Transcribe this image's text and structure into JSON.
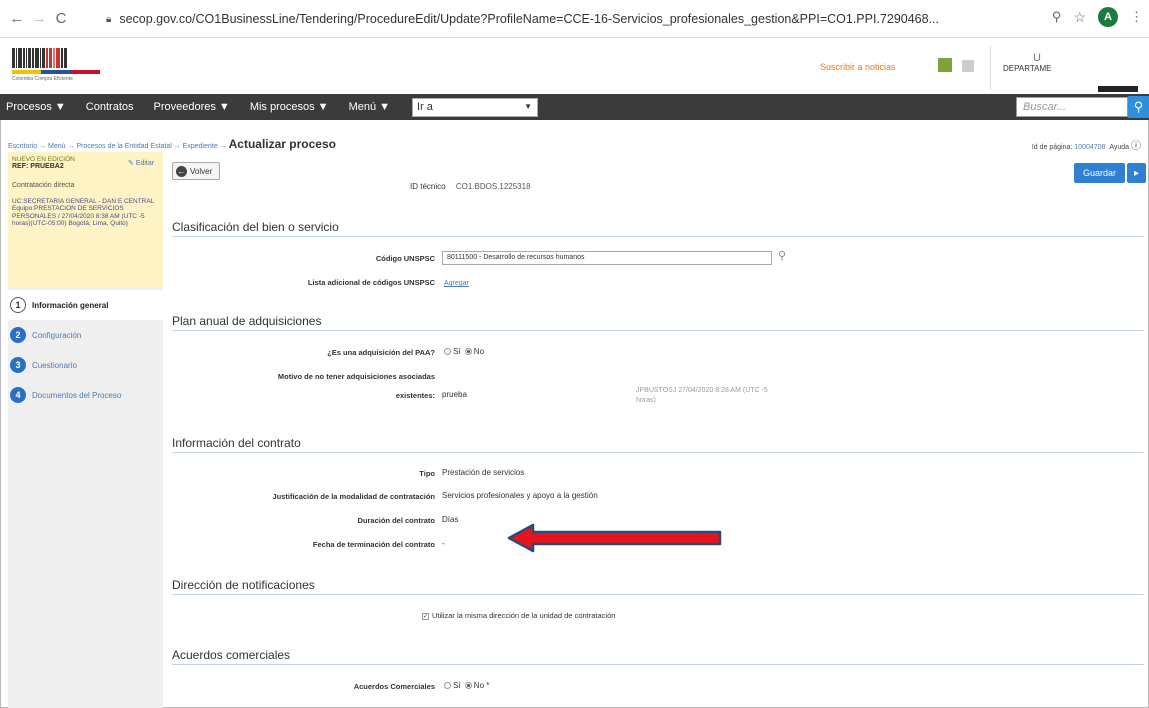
{
  "browser": {
    "url": "secop.gov.co/CO1BusinessLine/Tendering/ProcedureEdit/Update?ProfileName=CCE-16-Servicios_profesionales_gestion&PPI=CO1.PPI.7290468...",
    "avatar_letter": "A"
  },
  "header": {
    "logo_tagline": "Colombia Compra Eficiente",
    "links": "Suscribir a noticias",
    "dept_initials": "U",
    "dept_label": "DEPARTAME"
  },
  "menu": {
    "items": [
      "Procesos ▼",
      "Contratos",
      "Proveedores ▼",
      "Mis procesos ▼",
      "Menú ▼"
    ],
    "goto_value": "Ir a",
    "search_placeholder": "Buscar..."
  },
  "breadcrumb": {
    "path": "Escritorio → Menú → Procesos de la Entidad Estatal → Expediente → ",
    "current": "Actualizar proceso",
    "page_id_label": "Id de página:",
    "page_id": "10004708",
    "help": "Ayuda"
  },
  "sidebar": {
    "status": "NUEVO EN EDICIÓN",
    "edit": "Editar",
    "ref": "REF: PRUEBA2",
    "process_type": "Contratación directa",
    "uc": "UC:SECRETARIA GENERAL - DAN E CENTRAL",
    "team": "Equipo:PRESTACION DE SERVICIOS PERSONALES / 27/04/2020 8:38 AM (UTC -5 horas)(UTC-05:00) Bogotá, Lima, Quito)",
    "steps": [
      {
        "num": "1",
        "label": "Información general"
      },
      {
        "num": "2",
        "label": "Configuración"
      },
      {
        "num": "3",
        "label": "Cuestionario"
      },
      {
        "num": "4",
        "label": "Documentos del Proceso"
      }
    ]
  },
  "actions": {
    "back": "Volver",
    "save": "Guardar",
    "more": "▸"
  },
  "form": {
    "id_label": "ID técnico",
    "id_value": "CO1.BDOS.1225318",
    "sec_clasificacion": "Clasificación del bien o servicio",
    "unspsc_label": "Código UNSPSC",
    "unspsc_value": "80111500 - Desarrollo de recursos humanos",
    "extra_codes_label": "Lista adicional de códigos UNSPSC",
    "extra_codes_link": "Agregar",
    "sec_paa": "Plan anual de adquisiciones",
    "paa_question": "¿Es una adquisición del PAA?",
    "paa_yes": "Sí",
    "paa_no": "No",
    "motivo_label_1": "Motivo de no tener adquisiciones asociadas",
    "motivo_label_2": "existentes:",
    "motivo_value": "prueba",
    "motivo_note_1": "JPBUSTOSJ   27/04/2020 8:28 AM (UTC -5",
    "motivo_note_2": "horas)",
    "sec_contrato": "Información del contrato",
    "tipo_label": "Tipo",
    "tipo_value": "Prestación de servicios",
    "just_label": "Justificación de la modalidad de contratación",
    "just_value": "Servicios profesionales y apoyo a la gestión",
    "duracion_label": "Duración del contrato",
    "duracion_value": "Días",
    "fecha_label": "Fecha de terminación del contrato",
    "fecha_value": "-",
    "sec_notif": "Dirección de notificaciones",
    "notif_check": "Utilizar la misma dirección de la unidad de contratación",
    "sec_acuerdos": "Acuerdos comerciales",
    "acuerdos_label": "Acuerdos Comerciales",
    "acuerdos_yes": "Sí",
    "acuerdos_no": "No *"
  },
  "colors": {
    "menu_bg": "#3b3b3b",
    "accent_blue": "#2f7fd4",
    "arrow_red": "#e8141b",
    "arrow_outline": "#2b4a7a",
    "info_box": "#fdf3c4"
  }
}
